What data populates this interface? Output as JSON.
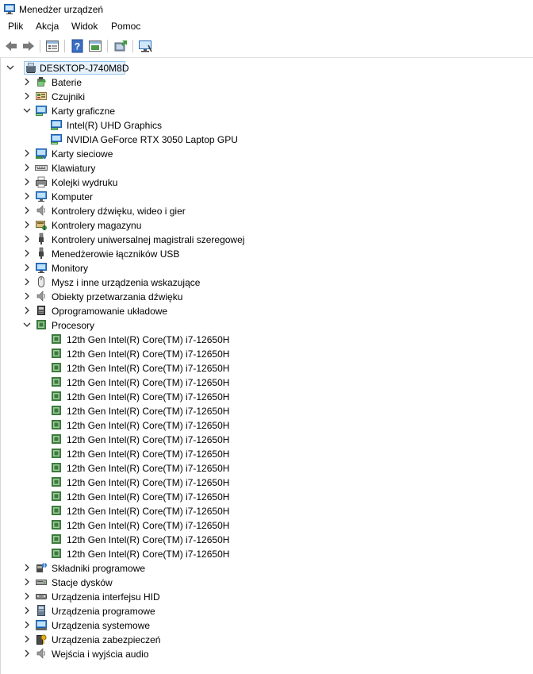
{
  "window": {
    "title": "Menedżer urządzeń"
  },
  "menu": [
    "Plik",
    "Akcja",
    "Widok",
    "Pomoc"
  ],
  "toolbar": {
    "buttons": [
      "back-arrow-icon",
      "forward-arrow-icon",
      "properties-icon",
      "help-icon",
      "view-icon",
      "update-driver-icon",
      "scan-hardware-icon"
    ]
  },
  "tree": {
    "root": "DESKTOP-J740M8D",
    "categories": [
      {
        "label": "Baterie",
        "icon": "battery-icon",
        "expanded": false
      },
      {
        "label": "Czujniki",
        "icon": "sensor-icon",
        "expanded": false
      },
      {
        "label": "Karty graficzne",
        "icon": "display-adapter-icon",
        "expanded": true,
        "children": [
          "Intel(R) UHD Graphics",
          "NVIDIA GeForce RTX 3050 Laptop GPU"
        ]
      },
      {
        "label": "Karty sieciowe",
        "icon": "network-adapter-icon",
        "expanded": false
      },
      {
        "label": "Klawiatury",
        "icon": "keyboard-icon",
        "expanded": false
      },
      {
        "label": "Kolejki wydruku",
        "icon": "printer-icon",
        "expanded": false
      },
      {
        "label": "Komputer",
        "icon": "computer-icon",
        "expanded": false
      },
      {
        "label": "Kontrolery dźwięku, wideo i gier",
        "icon": "speaker-icon",
        "expanded": false
      },
      {
        "label": "Kontrolery magazynu",
        "icon": "storage-controller-icon",
        "expanded": false
      },
      {
        "label": "Kontrolery uniwersalnej magistrali szeregowej",
        "icon": "usb-icon",
        "expanded": false
      },
      {
        "label": "Menedżerowie łączników USB",
        "icon": "usb-connector-icon",
        "expanded": false
      },
      {
        "label": "Monitory",
        "icon": "monitor-icon",
        "expanded": false
      },
      {
        "label": "Mysz i inne urządzenia wskazujące",
        "icon": "mouse-icon",
        "expanded": false
      },
      {
        "label": "Obiekty przetwarzania dźwięku",
        "icon": "audio-processing-icon",
        "expanded": false
      },
      {
        "label": "Oprogramowanie układowe",
        "icon": "firmware-icon",
        "expanded": false
      },
      {
        "label": "Procesory",
        "icon": "processor-icon",
        "expanded": true,
        "children": [
          "12th Gen Intel(R) Core(TM) i7-12650H",
          "12th Gen Intel(R) Core(TM) i7-12650H",
          "12th Gen Intel(R) Core(TM) i7-12650H",
          "12th Gen Intel(R) Core(TM) i7-12650H",
          "12th Gen Intel(R) Core(TM) i7-12650H",
          "12th Gen Intel(R) Core(TM) i7-12650H",
          "12th Gen Intel(R) Core(TM) i7-12650H",
          "12th Gen Intel(R) Core(TM) i7-12650H",
          "12th Gen Intel(R) Core(TM) i7-12650H",
          "12th Gen Intel(R) Core(TM) i7-12650H",
          "12th Gen Intel(R) Core(TM) i7-12650H",
          "12th Gen Intel(R) Core(TM) i7-12650H",
          "12th Gen Intel(R) Core(TM) i7-12650H",
          "12th Gen Intel(R) Core(TM) i7-12650H",
          "12th Gen Intel(R) Core(TM) i7-12650H",
          "12th Gen Intel(R) Core(TM) i7-12650H"
        ]
      },
      {
        "label": "Składniki programowe",
        "icon": "software-component-icon",
        "expanded": false
      },
      {
        "label": "Stacje dysków",
        "icon": "disk-drive-icon",
        "expanded": false
      },
      {
        "label": "Urządzenia interfejsu HID",
        "icon": "hid-icon",
        "expanded": false
      },
      {
        "label": "Urządzenia programowe",
        "icon": "software-device-icon",
        "expanded": false
      },
      {
        "label": "Urządzenia systemowe",
        "icon": "system-device-icon",
        "expanded": false
      },
      {
        "label": "Urządzenia zabezpieczeń",
        "icon": "security-device-icon",
        "expanded": false
      },
      {
        "label": "Wejścia i wyjścia audio",
        "icon": "audio-io-icon",
        "expanded": false
      }
    ]
  }
}
